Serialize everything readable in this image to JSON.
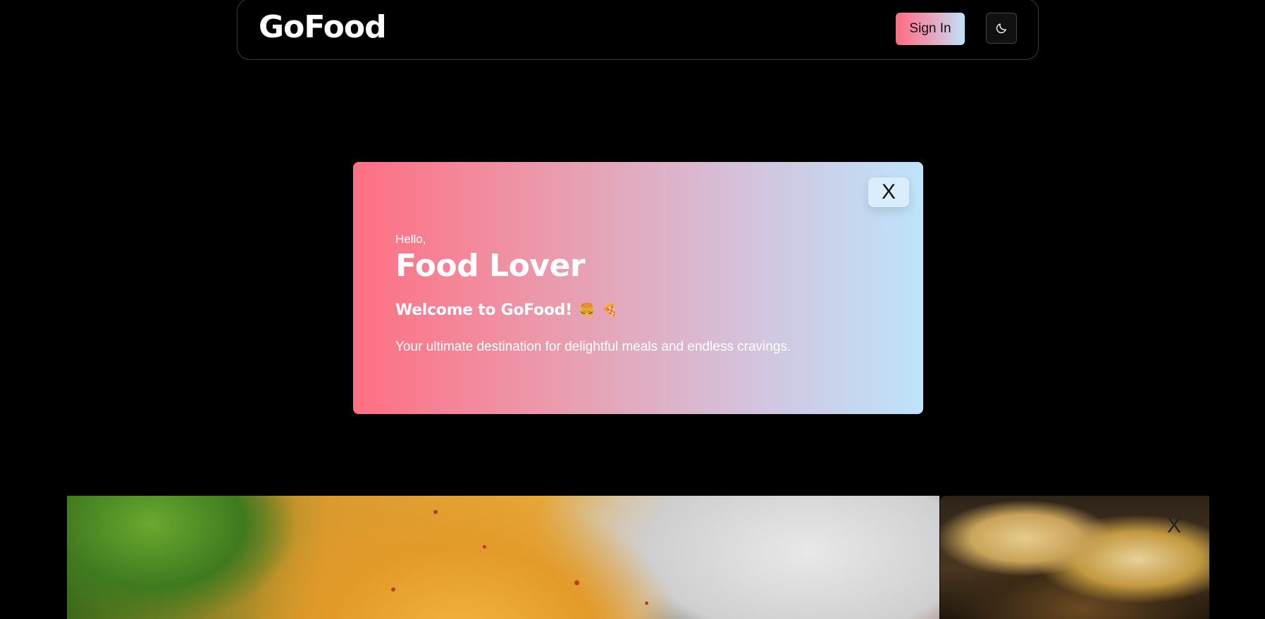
{
  "header": {
    "brand": "GoFood",
    "sign_in_label": "Sign In",
    "theme_toggle_icon": "moon-icon"
  },
  "modal": {
    "close_label": "X",
    "greeting": "Hello,",
    "headline": "Food Lover",
    "welcome": "Welcome to GoFood!",
    "welcome_emojis": [
      "🍔",
      "🍕"
    ],
    "tagline": "Your ultimate destination for delightful meals and endless cravings."
  },
  "carousel": {
    "side_close_label": "X"
  },
  "colors": {
    "background": "#000000",
    "gradient_start": "#ff6f82",
    "gradient_end": "#bde4fb"
  }
}
